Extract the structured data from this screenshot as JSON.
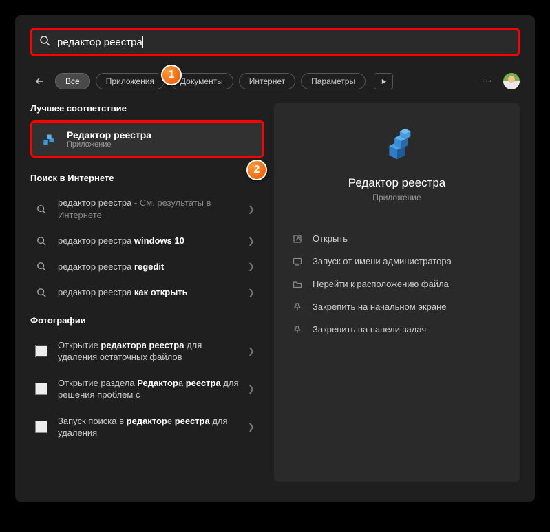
{
  "search": {
    "value": "редактор реестра"
  },
  "filters": {
    "all": "Все",
    "apps": "Приложения",
    "docs": "Документы",
    "web": "Интернет",
    "settings": "Параметры"
  },
  "sections": {
    "best_match": "Лучшее соответствие",
    "web_search": "Поиск в Интернете",
    "photos": "Фотографии"
  },
  "best": {
    "title": "Редактор реестра",
    "sub": "Приложение"
  },
  "web_results": [
    {
      "prefix": "редактор реестра",
      "suffix": " - См. результаты в Интернете"
    },
    {
      "prefix": "редактор реестра ",
      "bold": "windows 10"
    },
    {
      "prefix": "редактор реестра ",
      "bold": "regedit"
    },
    {
      "prefix": "редактор реестра ",
      "bold": "как открыть"
    }
  ],
  "photo_results": [
    "Открытие <b>редактора реестра</b> для удаления остаточных файлов",
    "Открытие раздела <b>Редактор</b>а <b>реестра</b> для решения проблем с",
    "Запуск поиска в <b>редактор</b>е <b>реестра</b> для удаления"
  ],
  "preview": {
    "title": "Редактор реестра",
    "sub": "Приложение"
  },
  "actions": {
    "open": "Открыть",
    "admin": "Запуск от имени администратора",
    "location": "Перейти к расположению файла",
    "pin_start": "Закрепить на начальном экране",
    "pin_task": "Закрепить на панели задач"
  },
  "callouts": {
    "one": "1",
    "two": "2"
  }
}
